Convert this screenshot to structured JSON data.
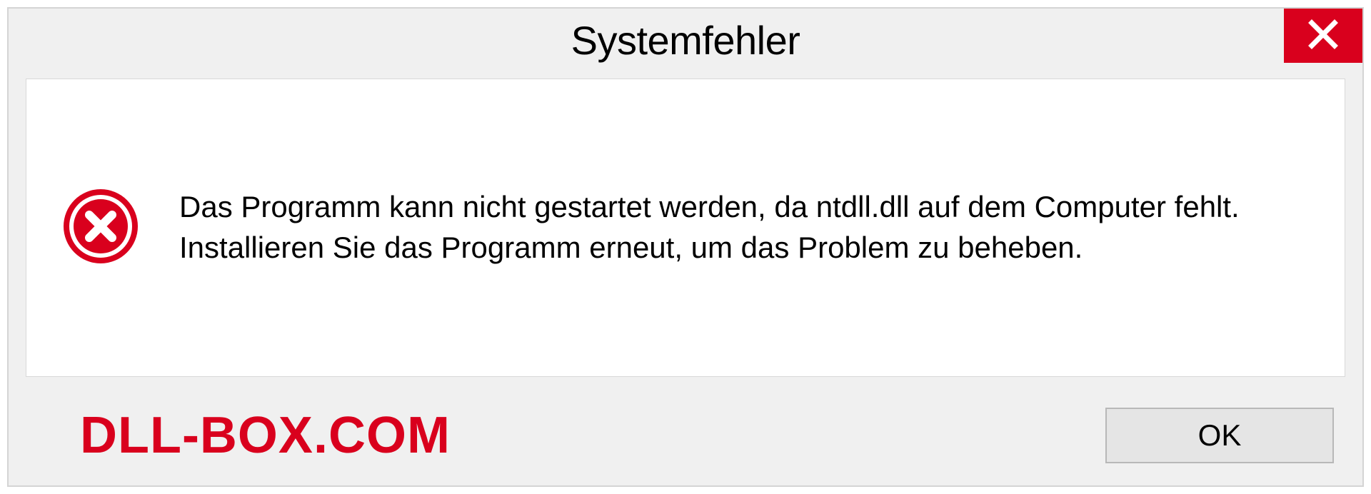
{
  "dialog": {
    "title": "Systemfehler",
    "message": "Das Programm kann nicht gestartet werden, da ntdll.dll auf dem Computer fehlt. Installieren Sie das Programm erneut, um das Problem zu beheben.",
    "ok_label": "OK"
  },
  "watermark": "DLL-BOX.COM",
  "colors": {
    "close_button": "#d9001d",
    "error_icon": "#d9001d",
    "watermark": "#d9001d"
  }
}
